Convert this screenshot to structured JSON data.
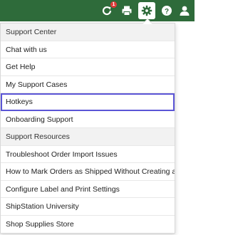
{
  "topbar": {
    "background": "#2e6b3a",
    "icons": [
      {
        "name": "refresh-notification-icon",
        "badge": "1"
      },
      {
        "name": "printer-icon"
      },
      {
        "name": "gear-icon",
        "active": true
      },
      {
        "name": "help-icon"
      },
      {
        "name": "user-icon"
      }
    ]
  },
  "menu": {
    "highlight_color": "#5b55d6",
    "items": [
      {
        "label": "Support Center",
        "type": "section"
      },
      {
        "label": "Chat with us",
        "type": "item"
      },
      {
        "label": "Get Help",
        "type": "item"
      },
      {
        "label": "My Support Cases",
        "type": "item"
      },
      {
        "label": "Hotkeys",
        "type": "item",
        "highlighted": true
      },
      {
        "label": "Onboarding Support",
        "type": "item"
      },
      {
        "label": "Support Resources",
        "type": "section"
      },
      {
        "label": "Troubleshoot Order Import Issues",
        "type": "item"
      },
      {
        "label": "How to Mark Orders as Shipped Without Creating a Label",
        "type": "item"
      },
      {
        "label": "Configure Label and Print Settings",
        "type": "item"
      },
      {
        "label": "ShipStation University",
        "type": "item"
      },
      {
        "label": "Shop Supplies Store",
        "type": "item"
      }
    ]
  }
}
